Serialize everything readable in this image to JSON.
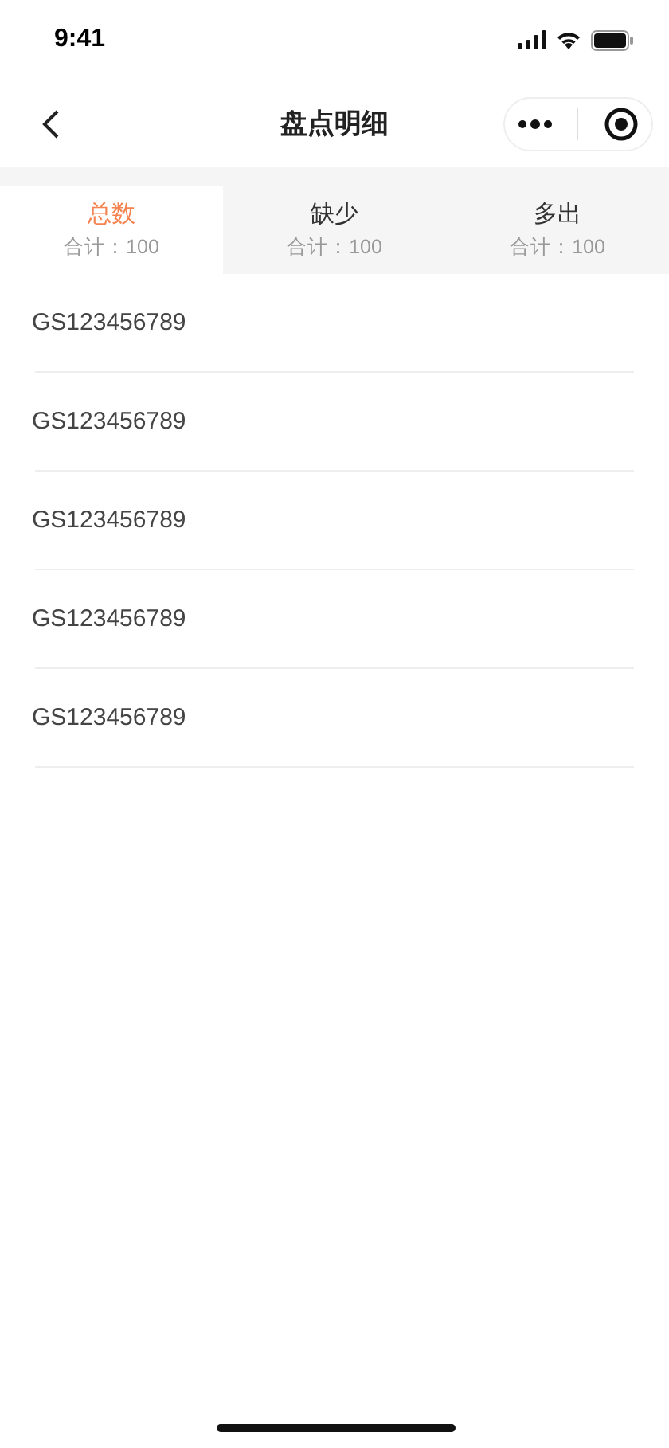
{
  "status_bar": {
    "time": "9:41"
  },
  "nav": {
    "title": "盘点明细"
  },
  "tabs": [
    {
      "label": "总数",
      "count": "合计：100",
      "selected": true
    },
    {
      "label": "缺少",
      "count": "合计：100",
      "selected": false
    },
    {
      "label": "多出",
      "count": "合计：100",
      "selected": false
    }
  ],
  "items": [
    {
      "code": "GS123456789"
    },
    {
      "code": "GS123456789"
    },
    {
      "code": "GS123456789"
    },
    {
      "code": "GS123456789"
    },
    {
      "code": "GS123456789"
    }
  ]
}
